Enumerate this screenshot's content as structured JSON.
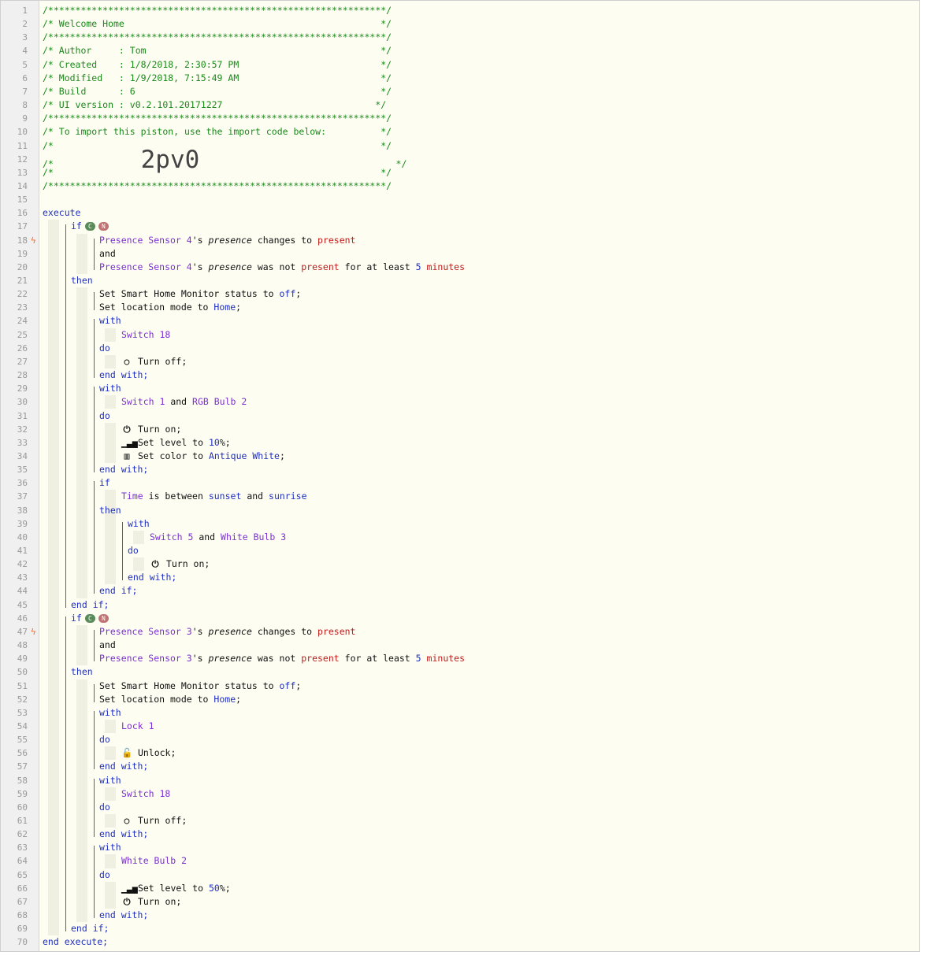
{
  "theme": {
    "comment": "#1a8a1a",
    "keyword": "#1f2fc4",
    "device": "#7d2fd6",
    "value": "#c21a1a",
    "trigger": "#ef6a2a"
  },
  "header": {
    "border": "/**************************************************************/",
    "title": "/* Welcome Home                                               */",
    "author": "/* Author     : Tom                                           */",
    "created": "/* Created    : 1/8/2018, 2:30:57 PM                          */",
    "modified": "/* Modified   : 1/9/2018, 7:15:49 AM                          */",
    "build": "/* Build      : 6                                             */",
    "ui_version": "/* UI version : v0.2.101.20171227                            */",
    "import_note": "/* To import this piston, use the import code below:          */",
    "empty": "/*                                                            */",
    "code_prefix": "/*                ",
    "code_suffix": "                                    */",
    "import_code": "2pv0"
  },
  "kw": {
    "execute": "execute",
    "end_execute": "end execute;",
    "if": "if",
    "then": "then",
    "and": "and",
    "with": "with",
    "do": "do",
    "end_with": "end with;",
    "end_if": "end if;"
  },
  "badges": {
    "c": "C",
    "n": "N"
  },
  "devices": {
    "presence4": "Presence Sensor 4",
    "presence3": "Presence Sensor 3",
    "switch18": "Switch 18",
    "switch1": "Switch 1",
    "rgb_bulb2": "RGB Bulb 2",
    "switch5": "Switch 5",
    "white_bulb3": "White Bulb 3",
    "lock1": "Lock 1",
    "white_bulb2": "White Bulb 2"
  },
  "text": {
    "possessive": "'s",
    "presence": "presence",
    "changes_to": "changes to",
    "present": "present",
    "was_not": "was not",
    "for_at_least": "for at least",
    "five": "5",
    "minutes": "minutes",
    "set_shm": "Set Smart Home Monitor status to",
    "off": "off",
    "semi": ";",
    "set_mode": "Set location mode to",
    "home": "Home",
    "turn_off": "Turn off;",
    "turn_on": "Turn on;",
    "and_word": "and",
    "set_level": "Set level to",
    "ten": "10",
    "fifty": "50",
    "pct": "%;",
    "set_color": "Set color to",
    "antique_white": "Antique White",
    "time": "Time",
    "is_between": "is between",
    "sunset": "sunset",
    "sunrise": "sunrise",
    "unlock": "Unlock;"
  },
  "icons": {
    "off": "○",
    "power": "⏻",
    "level": "▁▃▅",
    "color": "▥",
    "lock": "🔓"
  },
  "line_numbers": [
    1,
    2,
    3,
    4,
    5,
    6,
    7,
    8,
    9,
    10,
    11,
    12,
    13,
    14,
    15,
    16,
    17,
    18,
    19,
    20,
    21,
    22,
    23,
    24,
    25,
    26,
    27,
    28,
    29,
    30,
    31,
    32,
    33,
    34,
    35,
    36,
    37,
    38,
    39,
    40,
    41,
    42,
    43,
    44,
    45,
    46,
    47,
    48,
    49,
    50,
    51,
    52,
    53,
    54,
    55,
    56,
    57,
    58,
    59,
    60,
    61,
    62,
    63,
    64,
    65,
    66,
    67,
    68,
    69,
    70
  ]
}
